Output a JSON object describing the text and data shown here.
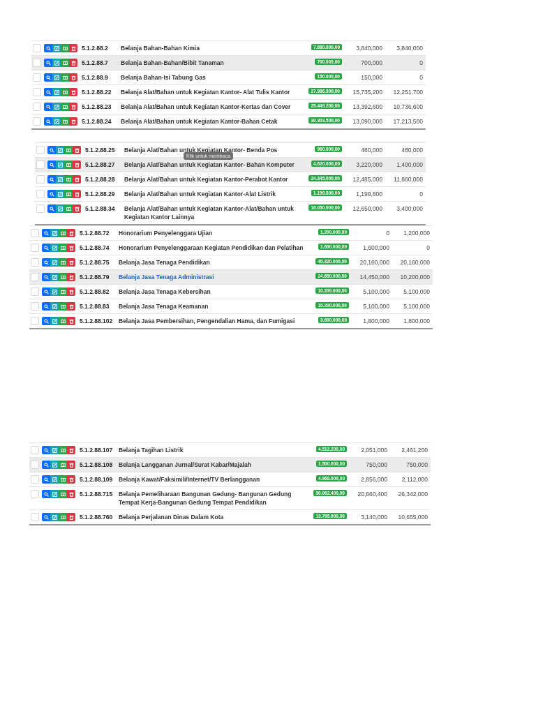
{
  "blocks": [
    {
      "rows": [
        {
          "code": "5.1.2.88.2",
          "name": "Belanja Bahan-Bahan Kimia",
          "amount": "7.680.000,00",
          "column_2": "3,840,000",
          "column_3": "3,840,000",
          "hovered": false,
          "link": false
        },
        {
          "code": "5.1.2.88.7",
          "name": "Belanja Bahan-Bahan/Bibit Tanaman",
          "amount": "700.000,00",
          "column_2": "700,000",
          "column_3": "0",
          "hovered": true,
          "link": false
        },
        {
          "code": "5.1.2.88.9",
          "name": "Belanja Bahan-Isi Tabung Gas",
          "amount": "150.000,00",
          "column_2": "150,000",
          "column_3": "0",
          "hovered": false,
          "link": false
        },
        {
          "code": "5.1.2.88.22",
          "name": "Belanja Alat/Bahan untuk Kegiatan Kantor- Alat Tulis Kantor",
          "amount": "27.986.900,00",
          "column_2": "15,735,200",
          "column_3": "12,251,700",
          "hovered": false,
          "link": false
        },
        {
          "code": "5.1.2.88.23",
          "name": "Belanja Alat/Bahan untuk Kegiatan Kantor-Kertas dan Cover",
          "amount": "25.449.200,00",
          "column_2": "13,392,600",
          "column_3": "10,736,600",
          "hovered": false,
          "link": false
        },
        {
          "code": "5.1.2.88.24",
          "name": "Belanja Alat/Bahan untuk Kegiatan Kantor-Bahan Cetak",
          "amount": "30.303.500,00",
          "column_2": "13,090,000",
          "column_3": "17,213,500",
          "hovered": false,
          "link": false
        }
      ]
    },
    {
      "rows": [
        {
          "code": "5.1.2.88.25",
          "name": "Belanja Alat/Bahan untuk Kegiatan Kantor- Benda Pos",
          "amount": "960.000,00",
          "column_2": "480,000",
          "column_3": "480,000",
          "hovered": false,
          "link": false
        },
        {
          "code": "5.1.2.88.27",
          "name": "Belanja Alat/Bahan untuk Kegiatan Kantor- Bahan Komputer",
          "amount": "4.620.000,00",
          "column_2": "3,220,000",
          "column_3": "1,400,000",
          "hovered": true,
          "link": false,
          "tooltip": "Klik untuk membaca"
        },
        {
          "code": "5.1.2.88.28",
          "name": "Belanja Alat/Bahan untuk Kegiatan Kantor-Perabot Kantor",
          "amount": "24.345.000,00",
          "column_2": "12,485,000",
          "column_3": "11,860,000",
          "hovered": false,
          "link": false
        },
        {
          "code": "5.1.2.88.29",
          "name": "Belanja Alat/Bahan untuk Kegiatan Kantor-Alat Listrik",
          "amount": "1.199.800,00",
          "column_2": "1,199,800",
          "column_3": "0",
          "hovered": false,
          "link": false
        },
        {
          "code": "5.1.2.88.34",
          "name": "Belanja Alat/Bahan untuk Kegiatan Kantor-Alat/Bahan untuk Kegiatan Kantor Lainnya",
          "amount": "16.050.000,00",
          "column_2": "12,650,000",
          "column_3": "3,400,000",
          "hovered": false,
          "link": false
        }
      ]
    },
    {
      "rows": [
        {
          "code": "5.1.2.88.72",
          "name": "Honorarium Penyelenggara Ujian",
          "amount": "1.200.000,00",
          "column_2": "0",
          "column_3": "1,200,000",
          "hovered": false,
          "link": false
        },
        {
          "code": "5.1.2.88.74",
          "name": "Honorarium Penyelenggaraan Kegiatan Pendidikan dan Pelatihan",
          "amount": "1.600.000,00",
          "column_2": "1,600,000",
          "column_3": "0",
          "hovered": false,
          "link": false
        },
        {
          "code": "5.1.2.88.75",
          "name": "Belanja Jasa Tenaga Pendidikan",
          "amount": "40.320.000,00",
          "column_2": "20,160,000",
          "column_3": "20,160,000",
          "hovered": false,
          "link": false
        },
        {
          "code": "5.1.2.88.79",
          "name": "Belanja Jasa Tenaga Administrasi",
          "amount": "24.650.000,00",
          "column_2": "14,450,000",
          "column_3": "10,200,000",
          "hovered": true,
          "link": true
        },
        {
          "code": "5.1.2.88.82",
          "name": "Belanja Jasa Tenaga Kebersihan",
          "amount": "10.200.000,00",
          "column_2": "5,100,000",
          "column_3": "5,100,000",
          "hovered": false,
          "link": false
        },
        {
          "code": "5.1.2.88.83",
          "name": "Belanja Jasa Tenaga Keamanan",
          "amount": "10.200.000,00",
          "column_2": "5,100,000",
          "column_3": "5,100,000",
          "hovered": false,
          "link": false
        },
        {
          "code": "5.1.2.88.102",
          "name": "Belanja Jasa Pembersihan, Pengendalian Hama, dan Fumigasi",
          "amount": "3.600.000,00",
          "column_2": "1,800,000",
          "column_3": "1,800,000",
          "hovered": false,
          "link": false
        }
      ]
    },
    {
      "rows": [
        {
          "code": "5.1.2.88.107",
          "name": "Belanja Tagihan Listrik",
          "amount": "4.512.200,00",
          "column_2": "2,051,000",
          "column_3": "2,461,200",
          "hovered": false,
          "link": false
        },
        {
          "code": "5.1.2.88.108",
          "name": "Belanja Langganan Jurnal/Surat Kabar/Majalah",
          "amount": "1.500.000,00",
          "column_2": "750,000",
          "column_3": "750,000",
          "hovered": true,
          "link": false
        },
        {
          "code": "5.1.2.88.109",
          "name": "Belanja Kawat/Faksimili/Internet/TV Berlangganan",
          "amount": "4.968.000,00",
          "column_2": "2,856,000",
          "column_3": "2,112,000",
          "hovered": false,
          "link": false
        },
        {
          "code": "5.1.2.88.715",
          "name": "Belanja Pemeliharaan Bangunan Gedung- Bangunan Gedung Tempat Kerja-Bangunan Gedung Tempat Pendidikan",
          "amount": "30.062.400,00",
          "column_2": "20,660,400",
          "column_3": "26,342,000",
          "hovered": false,
          "link": false
        },
        {
          "code": "5.1.2.88.760",
          "name": "Belanja Perjalanan Dinas Dalam Kota",
          "amount": "13.795.000,00",
          "column_2": "3,140,000",
          "column_3": "10,655,000",
          "hovered": false,
          "link": false
        }
      ]
    }
  ]
}
